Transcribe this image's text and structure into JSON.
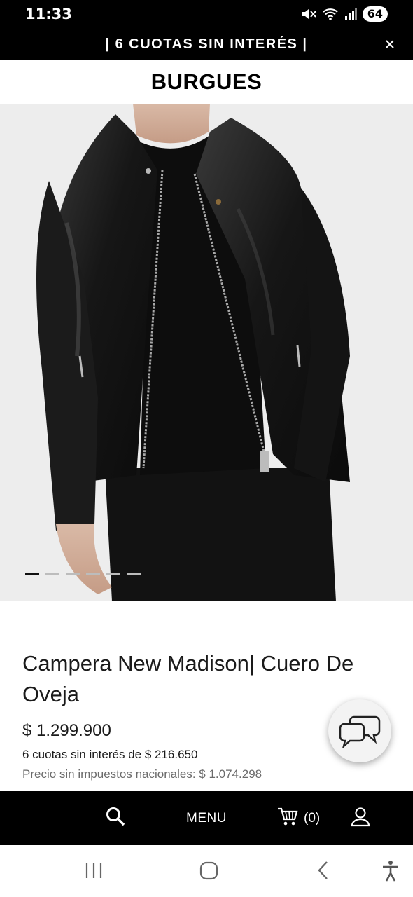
{
  "status_bar": {
    "time": "11:33",
    "battery": "64",
    "icons": [
      "mute-icon",
      "wifi-icon",
      "signal-icon"
    ]
  },
  "promo": {
    "text": "| 6 CUOTAS SIN INTERÉS |",
    "close_icon": "close-icon"
  },
  "brand": {
    "logo_text": "BURGUES"
  },
  "carousel": {
    "image_description_icon": "product-photo",
    "slide_count": 6,
    "active_index": 0
  },
  "product": {
    "title": "Campera New Madison| Cuero De Oveja",
    "price": "$ 1.299.900",
    "installments": "6 cuotas sin interés de $ 216.650",
    "price_no_tax": "Precio sin impuestos nacionales: $ 1.074.298"
  },
  "chat": {
    "icon": "chat-bubbles-icon"
  },
  "bottom_nav": {
    "search_icon": "search-icon",
    "menu_label": "MENU",
    "cart_icon": "cart-icon",
    "cart_count": "(0)",
    "account_icon": "user-icon"
  },
  "system_nav": {
    "recents_icon": "recents-icon",
    "home_icon": "home-icon",
    "back_icon": "back-icon",
    "accessibility_icon": "accessibility-icon"
  },
  "colors": {
    "bar_background": "#000000",
    "image_background": "#ededed",
    "text_primary": "#1a1a1a",
    "text_secondary": "#6b6b6b"
  }
}
